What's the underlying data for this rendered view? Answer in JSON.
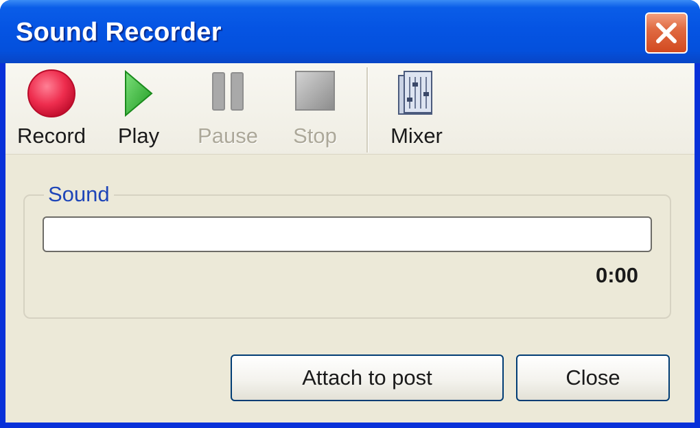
{
  "window": {
    "title": "Sound Recorder"
  },
  "toolbar": {
    "record": {
      "label": "Record",
      "icon": "record-icon",
      "enabled": true
    },
    "play": {
      "label": "Play",
      "icon": "play-icon",
      "enabled": true
    },
    "pause": {
      "label": "Pause",
      "icon": "pause-icon",
      "enabled": false
    },
    "stop": {
      "label": "Stop",
      "icon": "stop-icon",
      "enabled": false
    },
    "mixer": {
      "label": "Mixer",
      "icon": "mixer-icon",
      "enabled": true
    }
  },
  "sound": {
    "group_label": "Sound",
    "progress_fraction": 0,
    "time": "0:00"
  },
  "actions": {
    "attach_label": "Attach to post",
    "close_label": "Close"
  },
  "colors": {
    "titlebar": "#0554e3",
    "close_button": "#d9542b",
    "record": "#e8294a",
    "play": "#2fae2f",
    "group_label": "#1e45b8"
  }
}
